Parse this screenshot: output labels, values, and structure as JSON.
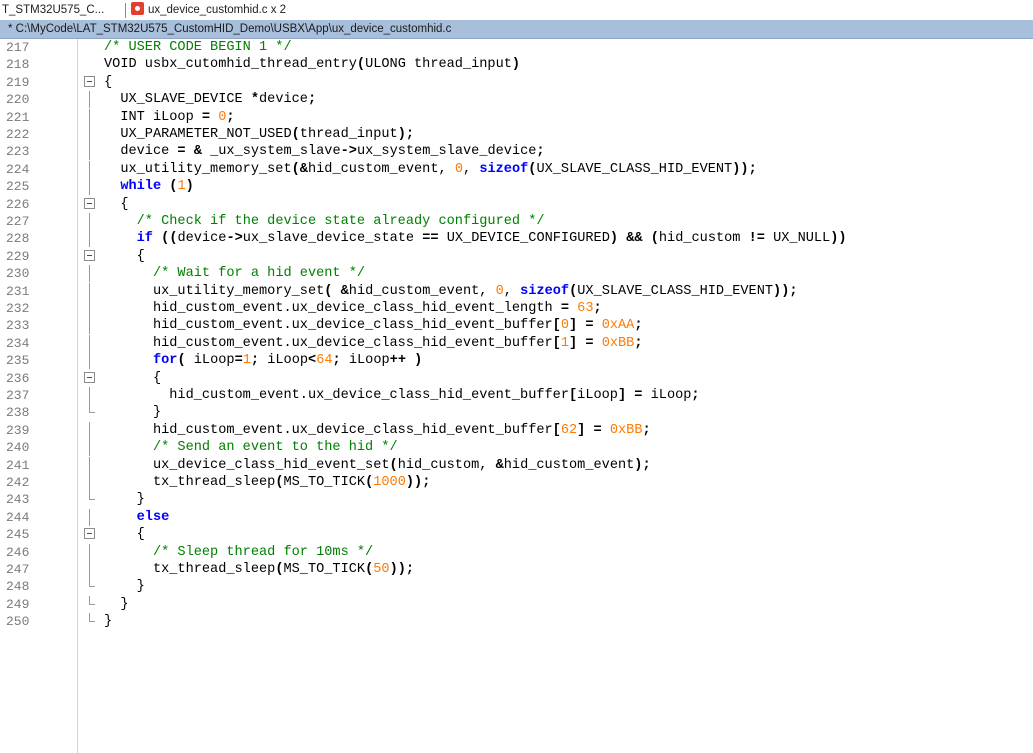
{
  "tabs": [
    {
      "label": "T_STM32U575_C..."
    },
    {
      "label": "ux_device_customhid.c x 2",
      "icon": "c-file-icon"
    }
  ],
  "file_path": "* C:\\MyCode\\LAT_STM32U575_CustomHID_Demo\\USBX\\App\\ux_device_customhid.c",
  "editor": {
    "lines": [
      {
        "n": "217",
        "t": "/* USER CODE BEGIN 1 */"
      },
      {
        "n": "218",
        "t": "VOID usbx_cutomhid_thread_entry(ULONG thread_input)"
      },
      {
        "n": "219",
        "t": "{"
      },
      {
        "n": "220",
        "t": "  UX_SLAVE_DEVICE *device;"
      },
      {
        "n": "221",
        "t": "  INT iLoop = 0;"
      },
      {
        "n": "222",
        "t": "  UX_PARAMETER_NOT_USED(thread_input);"
      },
      {
        "n": "223",
        "t": "  device = & _ux_system_slave->ux_system_slave_device;"
      },
      {
        "n": "224",
        "t": "  ux_utility_memory_set(&hid_custom_event, 0, sizeof(UX_SLAVE_CLASS_HID_EVENT));"
      },
      {
        "n": "225",
        "t": "  while (1)"
      },
      {
        "n": "226",
        "t": "  {"
      },
      {
        "n": "227",
        "t": "    /* Check if the device state already configured */"
      },
      {
        "n": "228",
        "t": "    if ((device->ux_slave_device_state == UX_DEVICE_CONFIGURED) && (hid_custom != UX_NULL))"
      },
      {
        "n": "229",
        "t": "    {"
      },
      {
        "n": "230",
        "t": "      /* Wait for a hid event */"
      },
      {
        "n": "231",
        "t": "      ux_utility_memory_set( &hid_custom_event, 0, sizeof(UX_SLAVE_CLASS_HID_EVENT));"
      },
      {
        "n": "232",
        "t": "      hid_custom_event.ux_device_class_hid_event_length = 63;"
      },
      {
        "n": "233",
        "t": "      hid_custom_event.ux_device_class_hid_event_buffer[0] = 0xAA;"
      },
      {
        "n": "234",
        "t": "      hid_custom_event.ux_device_class_hid_event_buffer[1] = 0xBB;"
      },
      {
        "n": "235",
        "t": "      for( iLoop=1; iLoop<64; iLoop++ )"
      },
      {
        "n": "236",
        "t": "      {"
      },
      {
        "n": "237",
        "t": "        hid_custom_event.ux_device_class_hid_event_buffer[iLoop] = iLoop;"
      },
      {
        "n": "238",
        "t": "      }"
      },
      {
        "n": "239",
        "t": "      hid_custom_event.ux_device_class_hid_event_buffer[62] = 0xBB;"
      },
      {
        "n": "240",
        "t": "      /* Send an event to the hid */"
      },
      {
        "n": "241",
        "t": "      ux_device_class_hid_event_set(hid_custom, &hid_custom_event);"
      },
      {
        "n": "242",
        "t": "      tx_thread_sleep(MS_TO_TICK(1000));"
      },
      {
        "n": "243",
        "t": "    }"
      },
      {
        "n": "244",
        "t": "    else"
      },
      {
        "n": "245",
        "t": "    {"
      },
      {
        "n": "246",
        "t": "      /* Sleep thread for 10ms */"
      },
      {
        "n": "247",
        "t": "      tx_thread_sleep(MS_TO_TICK(50));"
      },
      {
        "n": "248",
        "t": "    }"
      },
      {
        "n": "249",
        "t": "  }"
      },
      {
        "n": "250",
        "t": "}"
      }
    ]
  },
  "colors": {
    "comment": "#008000",
    "keyword": "#0000ff",
    "number": "#ff7a00",
    "operator": "#000080",
    "path_bar": "#a8bfdc",
    "line_number": "#7b7b7b"
  }
}
